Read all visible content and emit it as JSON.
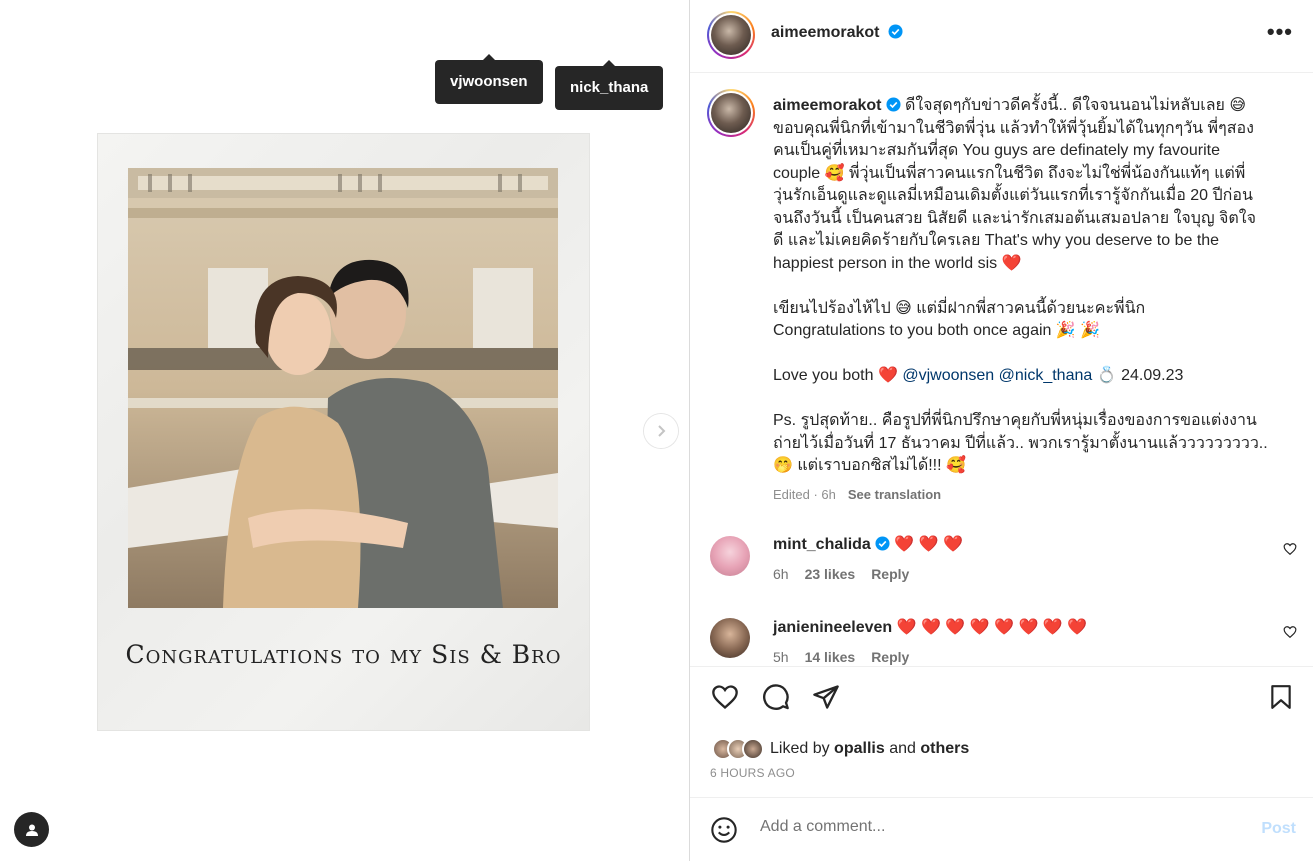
{
  "media": {
    "tags": [
      "vjwoonsen",
      "nick_thana"
    ],
    "overlay_caption": "Congratulations to my Sis & Bro",
    "next_icon": "chevron-right-icon",
    "user_tag_icon": "user-icon"
  },
  "header": {
    "username": "aimeemorakot",
    "more_label": "•••"
  },
  "caption": {
    "username": "aimeemorakot",
    "lines": [
      "ดีใจสุดๆกับข่าวดีครั้งนี้.. ดีใจจนนอนไม่หลับเลย 😅",
      "ขอบคุณพี่นิกที่เข้ามาในชีวิตพี่วุ่น แล้วทำให้พี่วุ้นยิ้มได้ในทุกๆวัน พี่ๆสอง",
      "คนเป็นคู่ที่เหมาะสมกันที่สุด You guys are definately my favourite",
      "couple 🥰 พี่วุ่นเป็นพี่สาวคนแรกในชีวิต ถึงจะไม่ใช่พี่น้องกันแท้ๆ แต่พี่",
      "วุ่นรักเอ็นดูและดูแลมี่เหมือนเดิมตั้งแต่วันแรกที่เรารู้จักกันเมื่อ 20 ปีก่อน",
      "จนถึงวันนี้ เป็นคนสวย นิสัยดี และน่ารักเสมอต้นเสมอปลาย ใจบุญ จิตใจ",
      "ดี และไม่เคยคิดร้ายกับใครเลย That's why you deserve to be the",
      "happiest person in the world sis ❤️"
    ],
    "para2": [
      "เขียนไปร้องไห้ไป 😅 แต่มี่ฝากพี่สาวคนนี้ด้วยนะคะพี่นิก",
      "Congratulations to you both once again 🎉 🎉"
    ],
    "para3_prefix": "Love you both ❤️",
    "mention1": "@vjwoonsen",
    "mention2": "@nick_thana",
    "para3_suffix": "💍 24.09.23",
    "para4": [
      "Ps. รูปสุดท้าย.. คือรูปที่พี่นิกปรึกษาคุยกับพี่หนุ่มเรื่องของการขอแต่งงาน",
      "ถ่ายไว้เมื่อวันที่ 17 ธันวาคม ปีที่แล้ว.. พวกเรารู้มาตั้งนานแล้ววววววววว..",
      "🤭 แต่เราบอกซิสไม่ได้!!! 🥰"
    ],
    "meta": "Edited · 6h",
    "see_translation": "See translation"
  },
  "comments": [
    {
      "username": "mint_chalida",
      "text": "❤️ ❤️ ❤️",
      "time": "6h",
      "likes": "23 likes",
      "reply": "Reply",
      "verified": true
    },
    {
      "username": "janienineeleven",
      "text": "❤️ ❤️ ❤️ ❤️ ❤️ ❤️ ❤️ ❤️",
      "time": "5h",
      "likes": "14 likes",
      "reply": "Reply",
      "verified": false
    }
  ],
  "actions": {
    "like_icon": "heart-icon",
    "comment_icon": "comment-icon",
    "share_icon": "share-icon",
    "save_icon": "bookmark-icon"
  },
  "likes": {
    "prefix": "Liked by",
    "user": "opallis",
    "connector": "and",
    "others": "others"
  },
  "time_ago": "6 HOURS AGO",
  "comment_box": {
    "placeholder": "Add a comment...",
    "post_label": "Post"
  },
  "colors": {
    "accent": "#0095f6",
    "verified": "#0095f6",
    "heart": "#e8173a",
    "mention": "#00376b"
  }
}
